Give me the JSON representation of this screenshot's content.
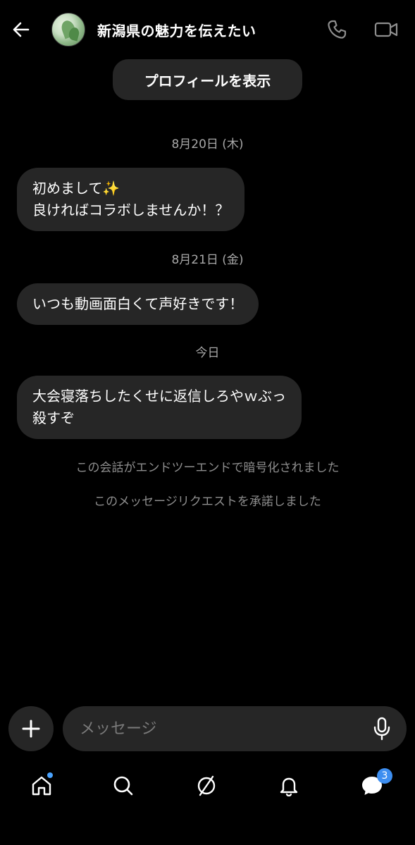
{
  "header": {
    "title": "新潟県の魅力を伝えたい"
  },
  "profile_button": {
    "label": "プロフィールを表示"
  },
  "conversation": [
    {
      "type": "date",
      "text": "8月20日 (木)"
    },
    {
      "type": "message",
      "lines": [
        "初めまして✨",
        "良ければコラボしませんか！？"
      ]
    },
    {
      "type": "date",
      "text": "8月21日 (金)"
    },
    {
      "type": "message",
      "lines": [
        "いつも動画面白くて声好きです！"
      ]
    },
    {
      "type": "date",
      "text": "今日"
    },
    {
      "type": "message",
      "lines": [
        "大会寝落ちしたくせに返信しろやｗぶっ",
        "殺すぞ"
      ]
    }
  ],
  "notices": [
    "この会話がエンドツーエンドで暗号化されました",
    "このメッセージリクエストを承諾しました"
  ],
  "composer": {
    "placeholder": "メッセージ",
    "value": ""
  },
  "nav": {
    "items": [
      "home",
      "search",
      "explore",
      "notifications",
      "messages"
    ],
    "messages_badge": "3"
  },
  "colors": {
    "background": "#000000",
    "bubble": "#262626",
    "accent": "#3d8ef0"
  }
}
